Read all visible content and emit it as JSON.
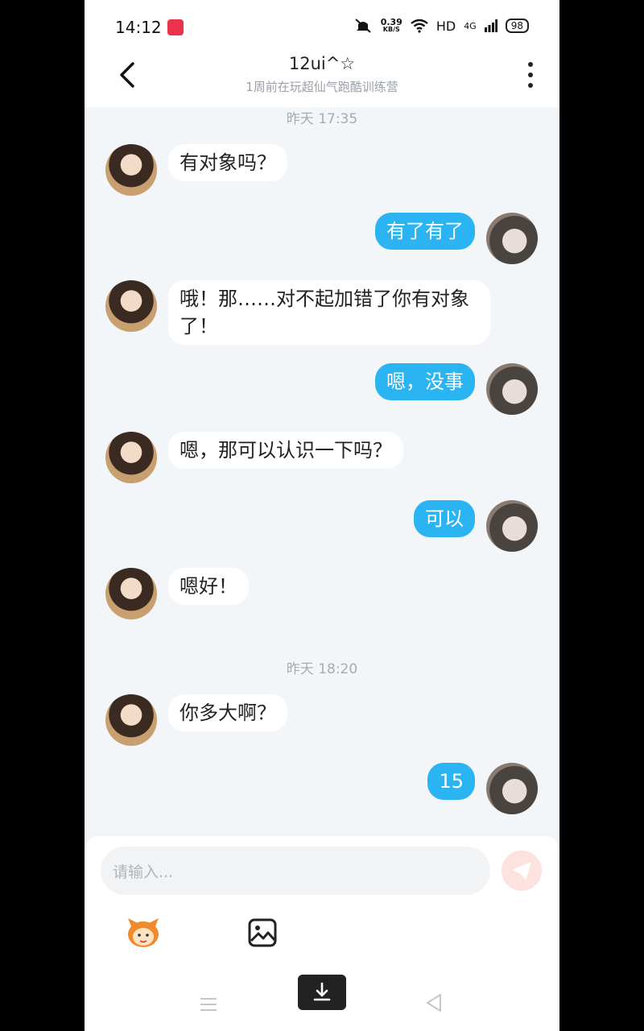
{
  "status": {
    "time": "14:12",
    "speed": "0.39",
    "speed_unit": "KB/S",
    "hd": "HD",
    "net": "4G",
    "battery": "98"
  },
  "header": {
    "title": "12ui^☆",
    "subtitle": "1周前在玩超仙气跑酷训练营"
  },
  "timestamps": [
    "昨天 17:35",
    "昨天 18:20"
  ],
  "messages": [
    {
      "side": "in",
      "text": "有对象吗？"
    },
    {
      "side": "out",
      "text": "有了有了"
    },
    {
      "side": "in",
      "text": "哦！那……对不起加错了你有对象",
      "text2": "了！"
    },
    {
      "side": "out",
      "text": "嗯，没事"
    },
    {
      "side": "in",
      "text": "嗯，那可以认识一下吗？"
    },
    {
      "side": "out",
      "text": "可以"
    },
    {
      "side": "in",
      "text": "嗯好！"
    },
    {
      "side": "in",
      "text": "你多大啊？"
    },
    {
      "side": "out",
      "text": "15"
    }
  ],
  "input": {
    "placeholder": "请输入..."
  },
  "icons": {
    "back": "chevron-left-icon",
    "more": "more-vertical-icon",
    "send": "send-icon",
    "emoji": "mascot-emoji-icon",
    "image": "image-icon"
  },
  "colors": {
    "outgoing_bubble": "#2bb4f2",
    "send_button": "#fde3e0"
  }
}
